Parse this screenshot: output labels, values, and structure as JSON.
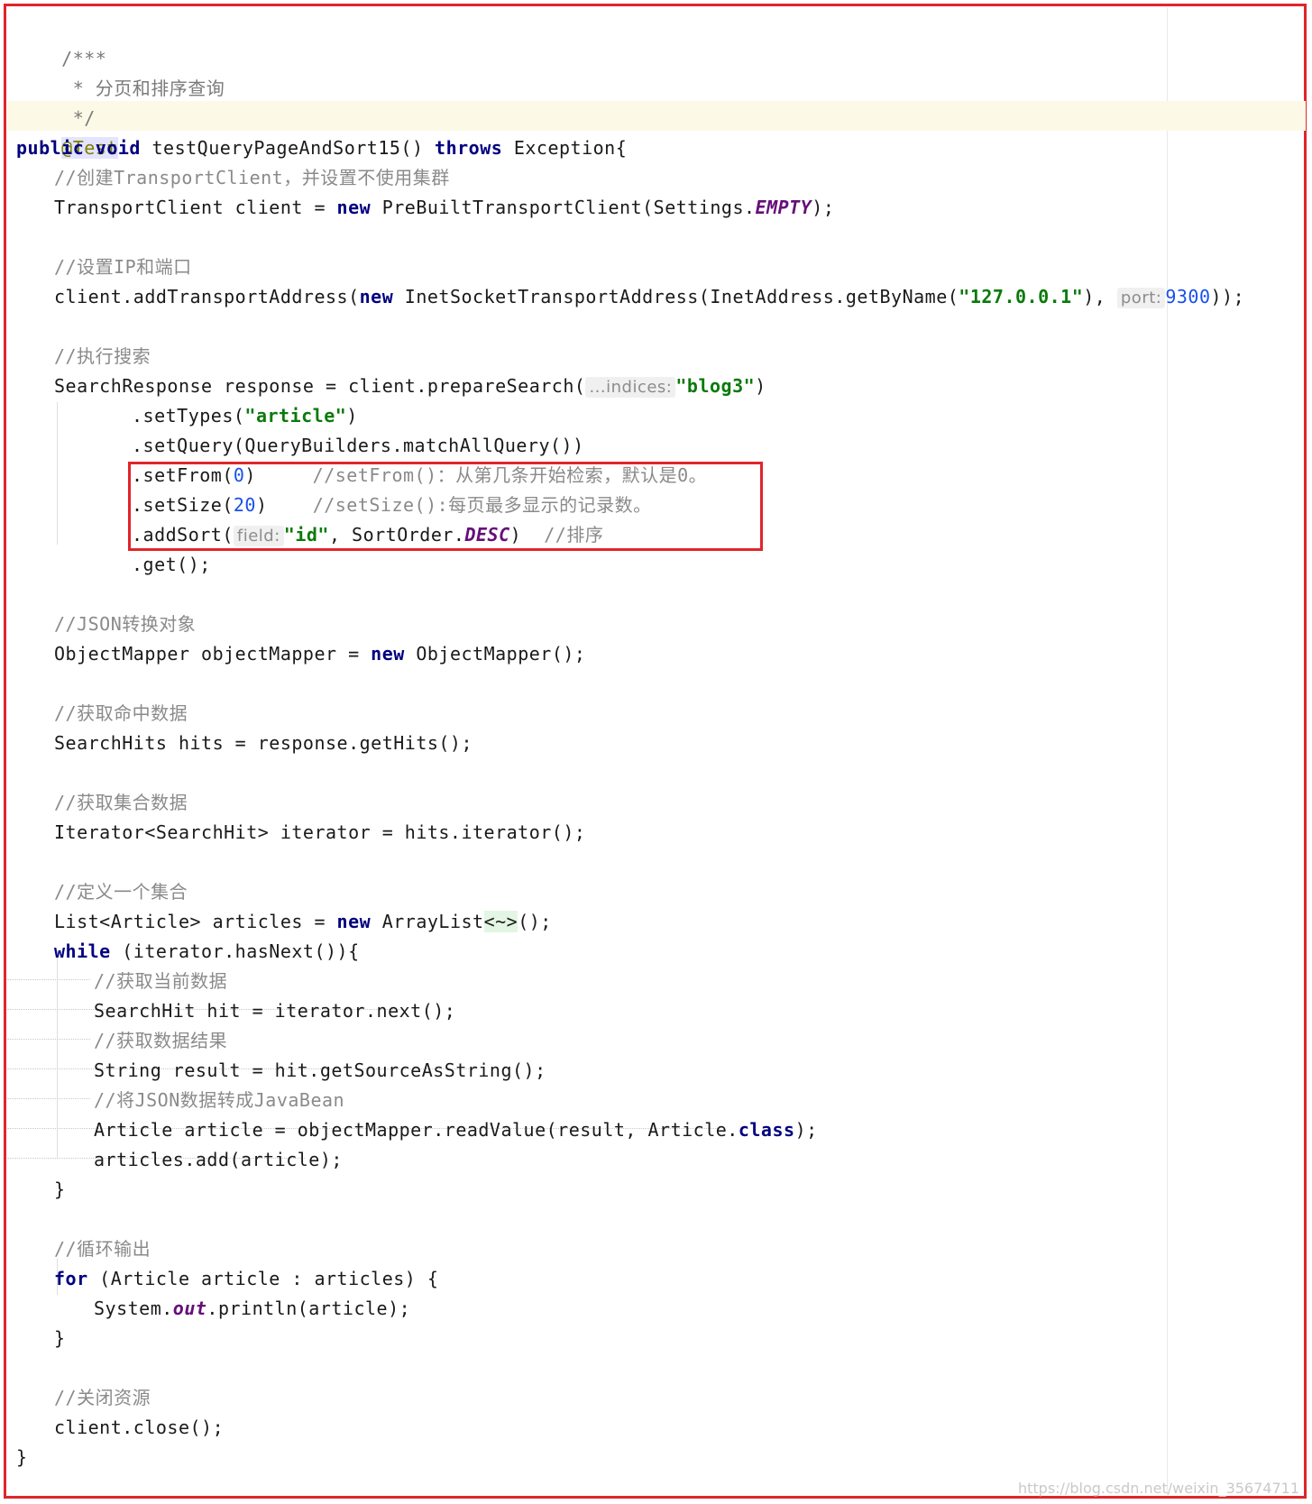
{
  "code": {
    "doc_open": "/***",
    "doc_title": " * 分页和排序查询",
    "doc_close": " */",
    "annotation": "@Test",
    "method_public": "public",
    "method_void": "void",
    "method_name": " testQueryPageAndSort15() ",
    "method_throws": "throws",
    "method_exception": " Exception{",
    "c_create_client": "//创建TransportClient，并设置不使用集群",
    "client_decl": "TransportClient client = ",
    "kw_new": "new",
    "client_ctor": " PreBuiltTransportClient(Settings.",
    "empty": "EMPTY",
    "client_end": ");",
    "c_set_ip": "//设置IP和端口",
    "addr_start": "client.addTransportAddress(",
    "addr_ctor": " InetSocketTransportAddress(InetAddress.getByName(",
    "ip_str": "\"127.0.0.1\"",
    "addr_comma": "), ",
    "hint_port": "port:",
    "port_val": "9300",
    "addr_end": "));",
    "c_exec_search": "//执行搜索",
    "search_start": "SearchResponse response = client.prepareSearch(",
    "hint_indices": "...indices:",
    "index_str": "\"blog3\"",
    "paren_close": ")",
    "set_types_start": ".setTypes(",
    "type_str": "\"article\"",
    "set_query": ".setQuery(QueryBuilders.matchAllQuery())",
    "set_from_start": ".setFrom(",
    "from_val": "0",
    "set_from_end": ")     ",
    "c_set_from": "//setFrom()：从第几条开始检索，默认是0。",
    "set_size_start": ".setSize(",
    "size_val": "20",
    "set_size_end": ")    ",
    "c_set_size": "//setSize():每页最多显示的记录数。",
    "add_sort_start": ".addSort(",
    "hint_field": "field:",
    "id_str": "\"id\"",
    "sort_mid": ", SortOrder.",
    "desc": "DESC",
    "sort_end": ")  ",
    "c_sort": "//排序",
    "get_call": ".get();",
    "c_json_obj": "//JSON转换对象",
    "mapper_decl": "ObjectMapper objectMapper = ",
    "mapper_end": " ObjectMapper();",
    "c_get_hits": "//获取命中数据",
    "hits_decl": "SearchHits hits = response.getHits();",
    "c_get_iter": "//获取集合数据",
    "iter_decl": "Iterator<SearchHit> iterator = hits.iterator();",
    "c_define_list": "//定义一个集合",
    "list_decl": "List<Article> articles = ",
    "list_ctor": " ArrayList",
    "diamond": "<~>",
    "list_end": "();",
    "kw_while": "while",
    "while_cond": " (iterator.hasNext()){",
    "c_cur_data": "//获取当前数据",
    "hit_decl": "SearchHit hit = iterator.next();",
    "c_result": "//获取数据结果",
    "result_decl": "String result = hit.getSourceAsString();",
    "c_to_bean": "//将JSON数据转成JavaBean",
    "article_decl": "Article article = objectMapper.readValue(result, Article.",
    "kw_class": "class",
    "article_end": ");",
    "add_article": "articles.add(article);",
    "brace_close": "}",
    "c_loop_out": "//循环输出",
    "kw_for": "for",
    "for_rest": " (Article article : articles) {",
    "println_start": "System.",
    "out": "out",
    "println_end": ".println(article);",
    "c_close_res": "//关闭资源",
    "client_close": "client.close();",
    "final_brace": "}"
  },
  "watermark": "https://blog.csdn.net/weixin_35674711",
  "colors": {
    "frame": "#e0252b",
    "keyword": "#000080",
    "string": "#0b7a0b",
    "number": "#1750eb",
    "comment": "#8a8a8a",
    "static_field": "#660e7a",
    "annotation": "#808000"
  }
}
